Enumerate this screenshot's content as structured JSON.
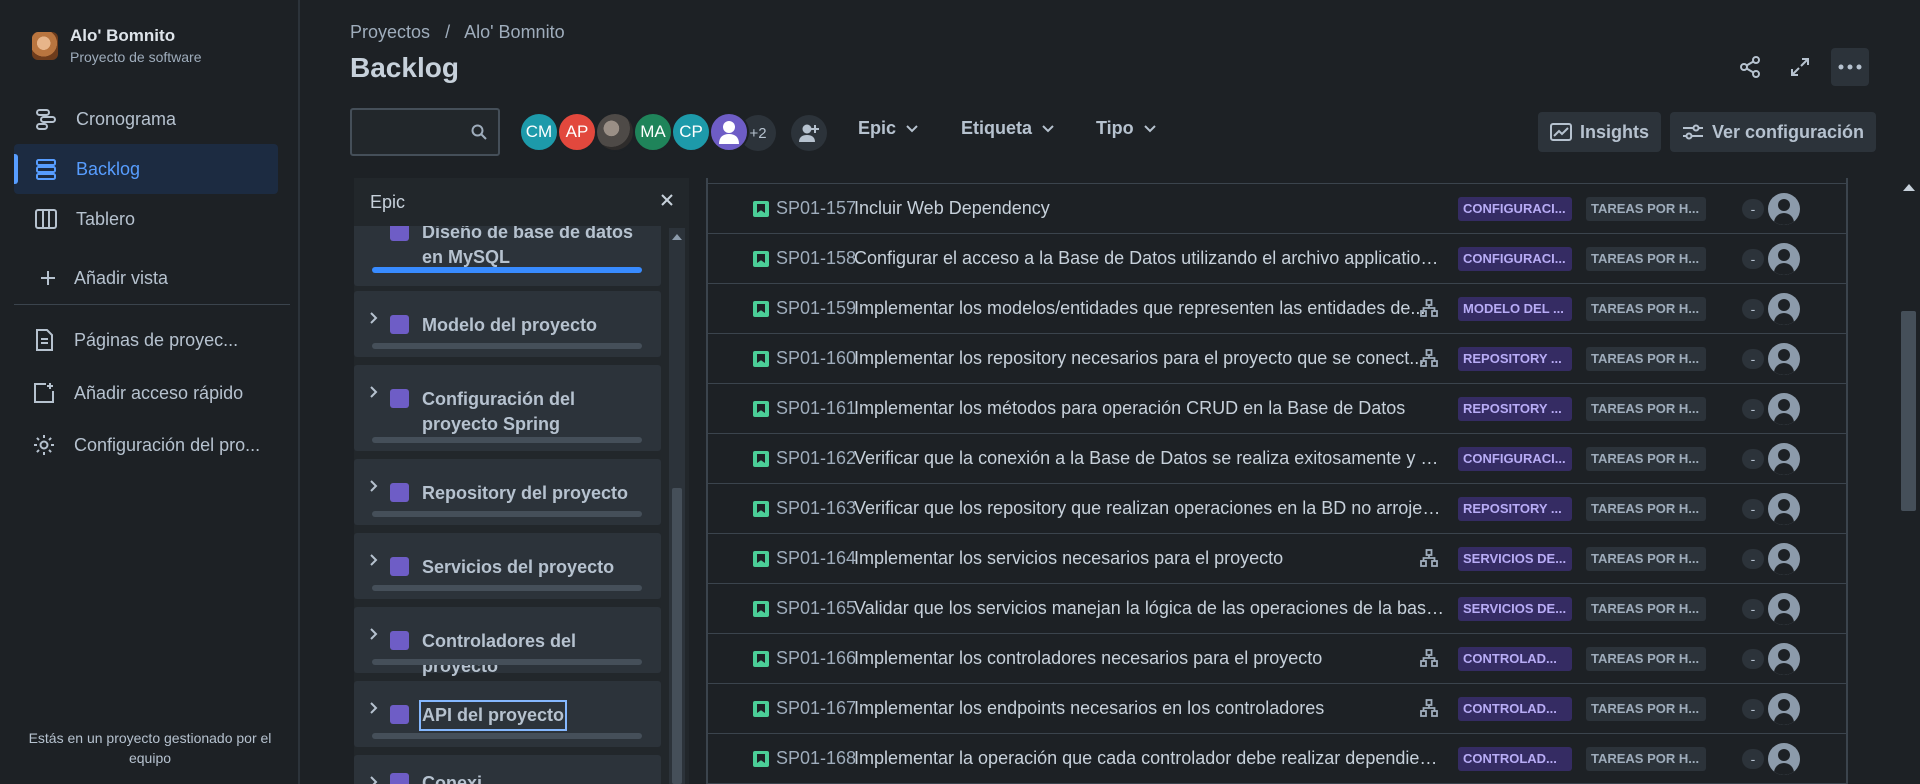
{
  "sidebar": {
    "project_name": "Alo' Bomnito",
    "project_type": "Proyecto de software",
    "nav": [
      {
        "label": "Cronograma",
        "icon": "timeline-icon"
      },
      {
        "label": "Backlog",
        "icon": "backlog-icon",
        "active": true
      },
      {
        "label": "Tablero",
        "icon": "board-icon"
      }
    ],
    "add_view": "Añadir vista",
    "links": [
      {
        "label": "Páginas de proyec...",
        "icon": "pages-icon"
      },
      {
        "label": "Añadir acceso rápido",
        "icon": "add-shortcut-icon"
      },
      {
        "label": "Configuración del pro...",
        "icon": "gear-icon"
      }
    ],
    "footer": "Estás en un proyecto gestionado por el equipo"
  },
  "header": {
    "breadcrumb": [
      "Proyectos",
      "/",
      "Alo' Bomnito"
    ],
    "title": "Backlog"
  },
  "toolbar": {
    "search_placeholder": "",
    "avatars": [
      {
        "initials": "CM",
        "color": "#1d9aaa"
      },
      {
        "initials": "AP",
        "color": "#e2483d"
      },
      {
        "initials": "",
        "color": "#5b5f66",
        "photo": true
      },
      {
        "initials": "MA",
        "color": "#1f845a"
      },
      {
        "initials": "CP",
        "color": "#1d9aaa"
      },
      {
        "initials": "",
        "color": "#6e5dc6",
        "user_icon": true
      }
    ],
    "more_count": "+2",
    "filters": [
      "Epic",
      "Etiqueta",
      "Tipo"
    ],
    "insights_label": "Insights",
    "settings_label": "Ver configuración"
  },
  "epic_panel": {
    "title": "Epic",
    "epics": [
      {
        "name": "Diseño de base de datos en MySQL",
        "progress": 1.0
      },
      {
        "name": "Modelo del proyecto",
        "progress": 0
      },
      {
        "name": "Configuración del proyecto Spring",
        "progress": 0
      },
      {
        "name": "Repository del proyecto",
        "progress": 0
      },
      {
        "name": "Servicios del proyecto",
        "progress": 0
      },
      {
        "name": "Controladores del proyecto",
        "progress": 0
      },
      {
        "name": "API del proyecto",
        "progress": 0
      },
      {
        "name": "Conexi...",
        "progress": 0
      }
    ]
  },
  "issues": [
    {
      "key": "SP01-157",
      "summary": "Incluir Web Dependency",
      "epic": "CONFIGURACI...",
      "label": "TAREAS POR H...",
      "estimate": "-",
      "has_children": false
    },
    {
      "key": "SP01-158",
      "summary": "Configurar el acceso a la Base de Datos utilizando el archivo application.pr...",
      "epic": "CONFIGURACI...",
      "label": "TAREAS POR H...",
      "estimate": "-",
      "has_children": false
    },
    {
      "key": "SP01-159",
      "summary": "Implementar los modelos/entidades que representen las entidades de...",
      "epic": "MODELO DEL ...",
      "label": "TAREAS POR H...",
      "estimate": "-",
      "has_children": true
    },
    {
      "key": "SP01-160",
      "summary": "Implementar los repository necesarios para el proyecto que se conect...",
      "epic": "REPOSITORY ...",
      "label": "TAREAS POR H...",
      "estimate": "-",
      "has_children": true
    },
    {
      "key": "SP01-161",
      "summary": "Implementar los métodos para operación CRUD en la Base de Datos",
      "epic": "REPOSITORY ...",
      "label": "TAREAS POR H...",
      "estimate": "-",
      "has_children": false
    },
    {
      "key": "SP01-162",
      "summary": "Verificar que la conexión a la Base de Datos se realiza exitosamente y sin e...",
      "epic": "CONFIGURACI...",
      "label": "TAREAS POR H...",
      "estimate": "-",
      "has_children": false
    },
    {
      "key": "SP01-163",
      "summary": "Verificar que los repository que realizan operaciones en la BD no arrojen e...",
      "epic": "REPOSITORY ...",
      "label": "TAREAS POR H...",
      "estimate": "-",
      "has_children": false
    },
    {
      "key": "SP01-164",
      "summary": "Implementar los servicios necesarios para el proyecto",
      "epic": "SERVICIOS DE...",
      "label": "TAREAS POR H...",
      "estimate": "-",
      "has_children": true
    },
    {
      "key": "SP01-165",
      "summary": "Validar que los servicios manejan la lógica de las operaciones de la base d...",
      "epic": "SERVICIOS DE...",
      "label": "TAREAS POR H...",
      "estimate": "-",
      "has_children": false
    },
    {
      "key": "SP01-166",
      "summary": "Implementar los controladores necesarios para el proyecto",
      "epic": "CONTROLAD...",
      "label": "TAREAS POR H...",
      "estimate": "-",
      "has_children": true
    },
    {
      "key": "SP01-167",
      "summary": "Implementar los endpoints necesarios en los controladores",
      "epic": "CONTROLAD...",
      "label": "TAREAS POR H...",
      "estimate": "-",
      "has_children": true
    },
    {
      "key": "SP01-168",
      "summary": "Implementar la operación que cada controlador debe realizar dependiend...",
      "epic": "CONTROLAD...",
      "label": "TAREAS POR H...",
      "estimate": "-",
      "has_children": false
    }
  ]
}
